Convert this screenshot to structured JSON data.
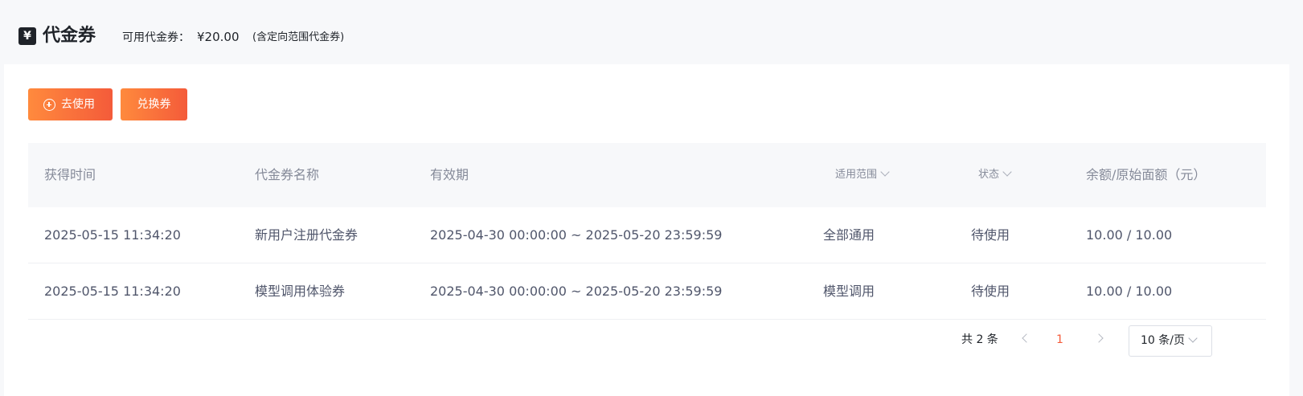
{
  "header": {
    "icon_glyph": "¥",
    "title": "代金券",
    "balance_label": "可用代金券：",
    "balance_value": "¥20.00",
    "balance_note": "(含定向范围代金券)"
  },
  "toolbar": {
    "use_label": "去使用",
    "redeem_label": "兑换券"
  },
  "table": {
    "columns": {
      "acquired_time": "获得时间",
      "coupon_name": "代金券名称",
      "validity": "有效期",
      "scope": "适用范围",
      "status": "状态",
      "balance": "余额/原始面额（元）"
    },
    "rows": [
      {
        "acquired_time": "2025-05-15 11:34:20",
        "coupon_name": "新用户注册代金券",
        "validity": "2025-04-30 00:00:00 ~ 2025-05-20 23:59:59",
        "scope": "全部通用",
        "status": "待使用",
        "balance": "10.00 / 10.00"
      },
      {
        "acquired_time": "2025-05-15 11:34:20",
        "coupon_name": "模型调用体验券",
        "validity": "2025-04-30 00:00:00 ~ 2025-05-20 23:59:59",
        "scope": "模型调用",
        "status": "待使用",
        "balance": "10.00 / 10.00"
      }
    ]
  },
  "pager": {
    "total": "共 2 条",
    "current_page": "1",
    "page_size": "10 条/页"
  },
  "colors": {
    "accent": "#f45b3a",
    "accent_gradient_start": "#ff8a3d",
    "header_bg": "#f7f8fa"
  }
}
